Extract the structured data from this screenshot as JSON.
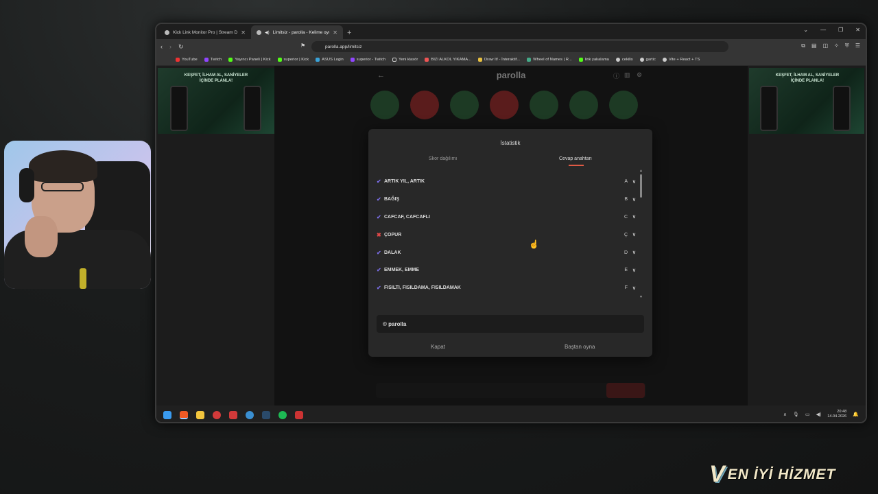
{
  "browser": {
    "tabs": [
      {
        "title": "Kick Link Monitor Pro | Stream Deck",
        "active": false
      },
      {
        "title": "Limitsiz - parolla - Kelime oyu",
        "active": true
      }
    ],
    "url": "parolla.app/limitsiz",
    "bookmarks": [
      "YouTube",
      "Twitch",
      "Yayıncı Paneli | Kick",
      "superior | Kick",
      "ASUS Login",
      "superior - Twitch",
      "Yeni klasör",
      "BIZI ALKOL YIKAMA...",
      "Draw It! - İnteraktif...",
      "Wheel of Names | R...",
      "link yakalama",
      "cekilis",
      "gartic",
      "Vite + React + TS"
    ]
  },
  "ads": {
    "left": "KEŞFET, İLHAM AL, SANİYELER İÇİNDE PLANLA!",
    "right": "KEŞFET, İLHAM AL, SANİYELER İÇİNDE PLANLA!"
  },
  "game": {
    "logo": "parolla",
    "modal": {
      "title": "İstatistik",
      "tab_score": "Skor dağılımı",
      "tab_answers": "Cevap anahtarı",
      "answers": [
        {
          "text": "ARTIK YIL, ARTIK",
          "letter": "A",
          "correct": true
        },
        {
          "text": "BAĞIŞ",
          "letter": "B",
          "correct": true
        },
        {
          "text": "CAFCAF, CAFCAFLI",
          "letter": "C",
          "correct": true
        },
        {
          "text": "ÇOPUR",
          "letter": "Ç",
          "correct": false
        },
        {
          "text": "DALAK",
          "letter": "D",
          "correct": true
        },
        {
          "text": "EMMEK, EMME",
          "letter": "E",
          "correct": true
        },
        {
          "text": "FISILTI, FISILDAMA, FISILDAMAK",
          "letter": "F",
          "correct": true
        }
      ],
      "credit": "© parolla",
      "close_label": "Kapat",
      "replay_label": "Baştan oyna"
    }
  },
  "taskbar": {
    "time": "20:48",
    "date": "14.04.2026"
  },
  "overlay": {
    "brand_letter": "V",
    "brand_text": "EN İYİ HİZMET"
  }
}
